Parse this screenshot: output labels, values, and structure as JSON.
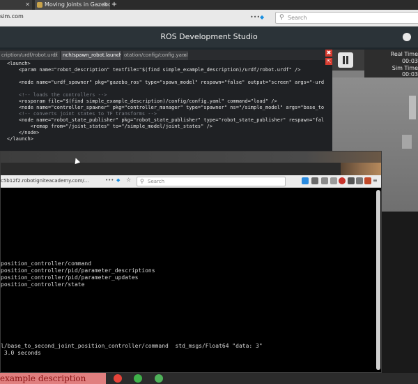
{
  "outer_browser": {
    "tabs": [
      {
        "label": "",
        "close": "✕"
      },
      {
        "label": "Moving Joints in Gazebo",
        "close": "✕"
      }
    ],
    "new_tab": "+",
    "url_tail": "sim.com",
    "search_placeholder": "Search"
  },
  "header": {
    "title": "ROS Development Studio"
  },
  "editor": {
    "tabs": [
      {
        "label": "cription/urdf/robot.urdf",
        "close": "x"
      },
      {
        "label": "nch/spawn_robot.launch",
        "close": "x"
      },
      {
        "label": "otation/config/config.yaml",
        "close": "x"
      }
    ],
    "active_tab": 1,
    "close_icon": "✖",
    "popout_icon": "⇱",
    "lines": [
      {
        "text": "<launch>",
        "comment": false
      },
      {
        "text": "    <param name=\"robot_description\" textfile=\"$(find simple_example_description)/urdf/robot.urdf\" />",
        "comment": false
      },
      {
        "text": "",
        "comment": false
      },
      {
        "text": "    <node name=\"urdf_spawner\" pkg=\"gazebo_ros\" type=\"spawn_model\" respawn=\"false\" output=\"screen\" args=\"-urdf",
        "comment": false
      },
      {
        "text": "",
        "comment": false
      },
      {
        "text": "    <!-- loads the controllers -->",
        "comment": true
      },
      {
        "text": "    <rosparam file=\"$(find simple_example_description)/config/config.yaml\" command=\"load\" />",
        "comment": false
      },
      {
        "text": "    <node name=\"controller_spawner\" pkg=\"controller_manager\" type=\"spawner\" ns=\"/simple_model\" args=\"base_to_se",
        "comment": false
      },
      {
        "text": "    <!-- converts joint states to TF transforms -->",
        "comment": true
      },
      {
        "text": "    <node name=\"robot_state_publisher\" pkg=\"robot_state_publisher\" type=\"robot_state_publisher\" respawn=\"false\"",
        "comment": false
      },
      {
        "text": "        <remap from=\"/joint_states\" to=\"/simple_model/joint_states\" />",
        "comment": false
      },
      {
        "text": "    </node>",
        "comment": false
      },
      {
        "text": "</launch>",
        "comment": false
      }
    ]
  },
  "gazebo": {
    "real_time_label": "Real Time",
    "real_time_value": "00:03",
    "sim_time_label": "Sim Time",
    "sim_time_value": "00:03"
  },
  "inner_browser": {
    "url": "c5b12f2.robotigniteacademy.com/",
    "url_trail": "…",
    "search_placeholder": "Search"
  },
  "terminal": {
    "lines": [
      "position_controller/command",
      "position_controller/pid/parameter_descriptions",
      "position_controller/pid/parameter_updates",
      "position_controller/state",
      "",
      "",
      "l/base_to_second_joint_position_controller/command  std_msgs/Float64 \"data: 3\"",
      " 3.0 seconds"
    ]
  },
  "status_bar": {
    "label": "example description"
  },
  "colors": {
    "accent_red": "#d83b2f",
    "status_red": "#e07f7f",
    "power_icon": "#e8443a",
    "help_icon": "#3fb24a",
    "chat_icon": "#4fb35a"
  }
}
